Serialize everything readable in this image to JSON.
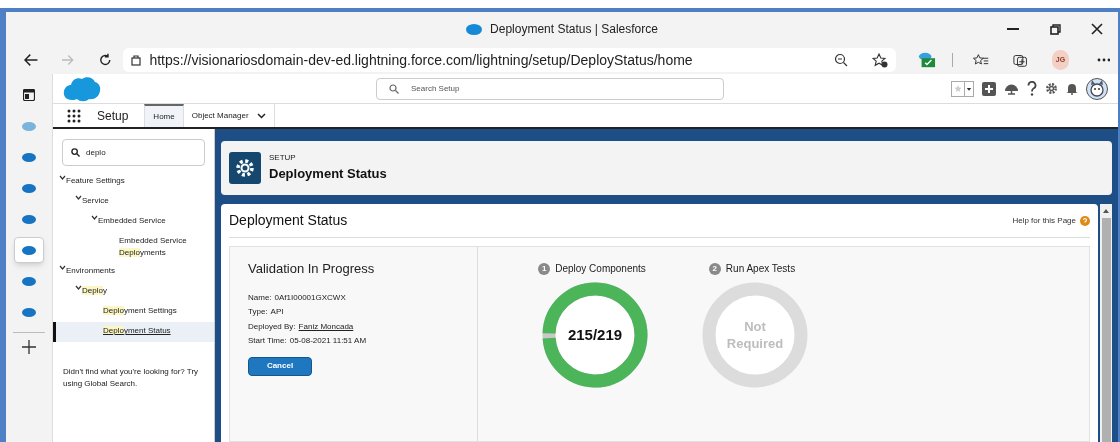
{
  "window": {
    "title": "Deployment Status | Salesforce"
  },
  "address_bar": {
    "url": "https://visionariosdomain-dev-ed.lightning.force.com/lightning/setup/DeployStatus/home"
  },
  "profile": {
    "initials": "JG"
  },
  "vertical_tabs": [
    {
      "kind": "panel",
      "selected": false
    },
    {
      "kind": "cloud",
      "selected": false
    },
    {
      "kind": "cloud",
      "selected": false
    },
    {
      "kind": "cloud",
      "selected": false
    },
    {
      "kind": "cloud",
      "selected": false
    },
    {
      "kind": "cloud",
      "selected": true
    },
    {
      "kind": "cloud",
      "selected": false
    },
    {
      "kind": "cloud",
      "selected": false
    }
  ],
  "header": {
    "search": {
      "placeholder": "Search Setup"
    }
  },
  "nav": {
    "app": "Setup",
    "tabs": [
      {
        "label": "Home",
        "selected": true,
        "menu": false
      },
      {
        "label": "Object Manager",
        "selected": false,
        "menu": true
      }
    ]
  },
  "sidebar": {
    "search": {
      "value": "deplo"
    },
    "tree": [
      {
        "label": "Feature Settings",
        "expanded": true,
        "selected": false,
        "children": [
          {
            "label": "Service",
            "expanded": true,
            "selected": false,
            "children": [
              {
                "label": "Embedded Service",
                "expanded": true,
                "selected": false,
                "children": [
                  {
                    "label": "Embedded Service **Deplo**yments",
                    "selected": false
                  }
                ]
              }
            ]
          }
        ]
      },
      {
        "label": "Environments",
        "expanded": true,
        "selected": false,
        "children": [
          {
            "label": "**Deplo**y",
            "expanded": true,
            "selected": false,
            "children": [
              {
                "label": "**Deplo**yment Settings",
                "selected": false
              },
              {
                "label": "**Deplo**yment Status",
                "selected": true
              }
            ]
          }
        ]
      }
    ],
    "footer": "Didn't find what you're looking for? Try using Global Search."
  },
  "page_header": {
    "eyebrow": "SETUP",
    "title": "Deployment Status"
  },
  "content": {
    "title": "Deployment Status",
    "help": "Help for this Page",
    "validation": {
      "title": "Validation In Progress",
      "fields": [
        {
          "label": "Name:",
          "value": "0Af1I00001GXCWX",
          "link": false
        },
        {
          "label": "Type:",
          "value": "API",
          "link": false
        },
        {
          "label": "Deployed By:",
          "value": "Faniz Moncada",
          "link": true
        },
        {
          "label": "Start Time:",
          "value": "05-08-2021 11:51 AM",
          "link": false
        }
      ],
      "button": "Cancel"
    },
    "steps": [
      {
        "number": "1",
        "label": "Deploy Components",
        "kind": "progress",
        "level": 0.982,
        "reading": "215/219"
      },
      {
        "number": "2",
        "label": "Run Apex Tests",
        "kind": "not_required",
        "reading": "Not Required"
      }
    ]
  }
}
